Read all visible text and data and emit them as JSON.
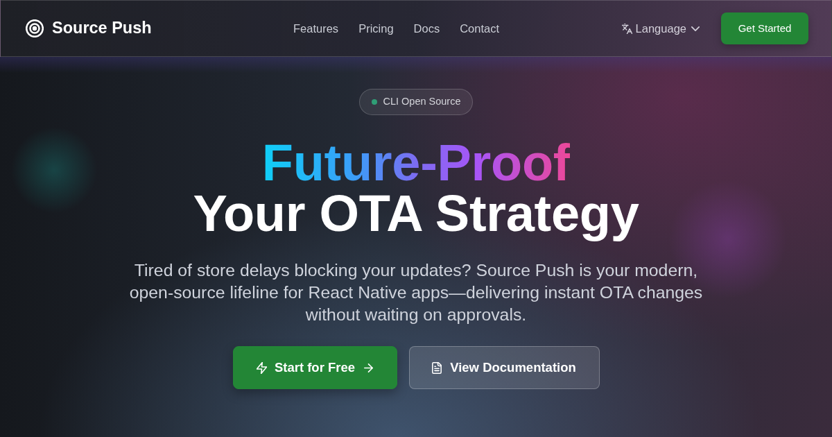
{
  "navbar": {
    "brand": "Source Push",
    "links": [
      {
        "label": "Features"
      },
      {
        "label": "Pricing"
      },
      {
        "label": "Docs"
      },
      {
        "label": "Contact"
      }
    ],
    "language": {
      "label": "Language"
    },
    "cta": {
      "label": "Get Started"
    }
  },
  "hero": {
    "badge": {
      "label": "CLI Open Source"
    },
    "headline": [
      {
        "text": "Future-Proof",
        "kind": "gradient"
      },
      {
        "text": "Your OTA Strategy",
        "kind": "plain"
      }
    ],
    "description": "Tired of store delays blocking your updates? Source Push is your modern, open-source lifeline for React Native apps—delivering instant OTA changes without waiting on approvals.",
    "buttons": [
      {
        "label": "Start for Free",
        "kind": "primary"
      },
      {
        "label": "View Documentation",
        "kind": "secondary"
      }
    ]
  }
}
